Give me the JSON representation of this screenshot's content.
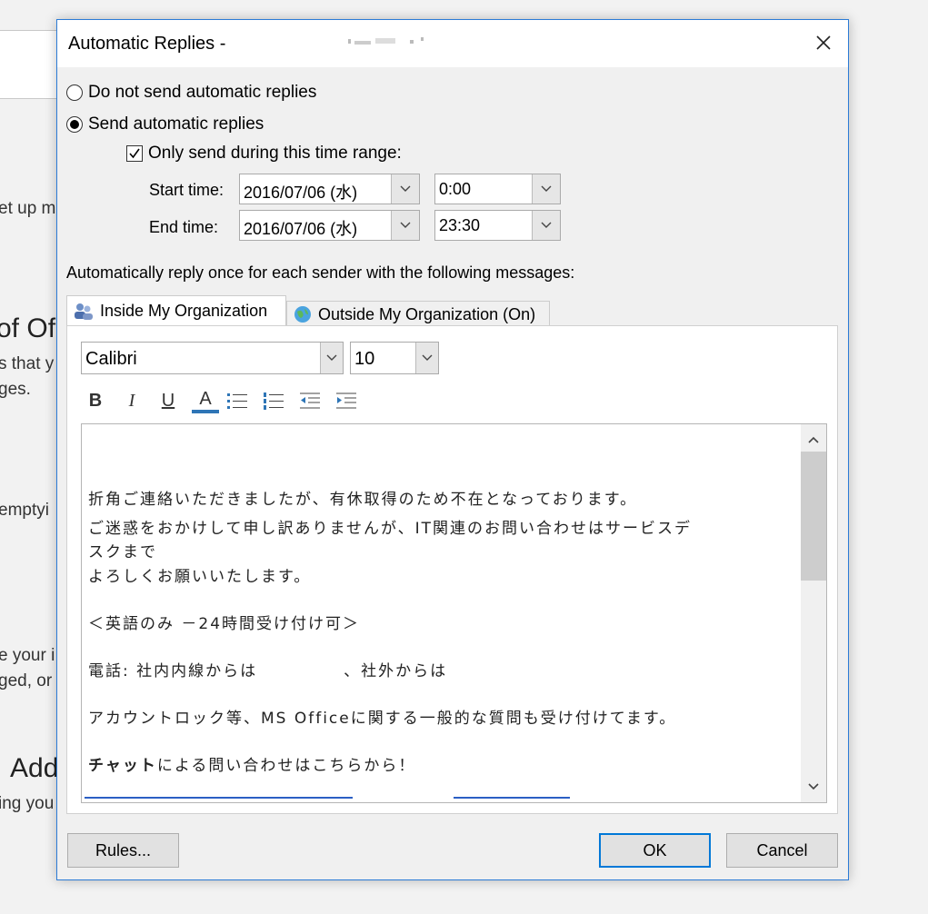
{
  "background": {
    "fragments": [
      "et up m",
      "of Of",
      "s that y",
      "ges.",
      "emptyi",
      "e your i",
      "ged, or",
      "Add",
      "ing you"
    ]
  },
  "dialog": {
    "title": "Automatic Replies -",
    "accent": "#2b7bd6",
    "close_label": "Close",
    "options": {
      "do_not_send": "Do not send automatic replies",
      "send": "Send automatic replies",
      "selected": "send"
    },
    "time_range": {
      "checkbox_label": "Only send during this time range:",
      "checked": true,
      "start_label": "Start time:",
      "end_label": "End time:",
      "start_date": "2016/07/06 (水)",
      "start_time": "0:00",
      "end_date": "2016/07/06 (水)",
      "end_time": "23:30"
    },
    "instruction": "Automatically reply once for each sender with the following messages:",
    "tabs": [
      {
        "label": "Inside My Organization",
        "active": true
      },
      {
        "label": "Outside My Organization (On)",
        "active": false
      }
    ],
    "editor": {
      "font": "Calibri",
      "size": "10",
      "toolbar": [
        "B",
        "I",
        "U",
        "A"
      ],
      "lines": [
        "折角ご連絡いただきましたが、有休取得のため不在となっております。",
        "ご迷惑をおかけして申し訳ありませんが、IT関連のお問い合わせはサービスデ",
        "スクまで",
        "よろしくお願いいたします。",
        "＜英語のみ －24時間受け付け可＞",
        "電話: 社内内線からは　　　　　、社外からは",
        "アカウントロック等、MS Officeに関する一般的な質問も受け付けてます。",
        "チャット",
        "による問い合わせはこちらから！"
      ]
    },
    "buttons": {
      "rules": "Rules...",
      "ok": "OK",
      "cancel": "Cancel"
    }
  }
}
